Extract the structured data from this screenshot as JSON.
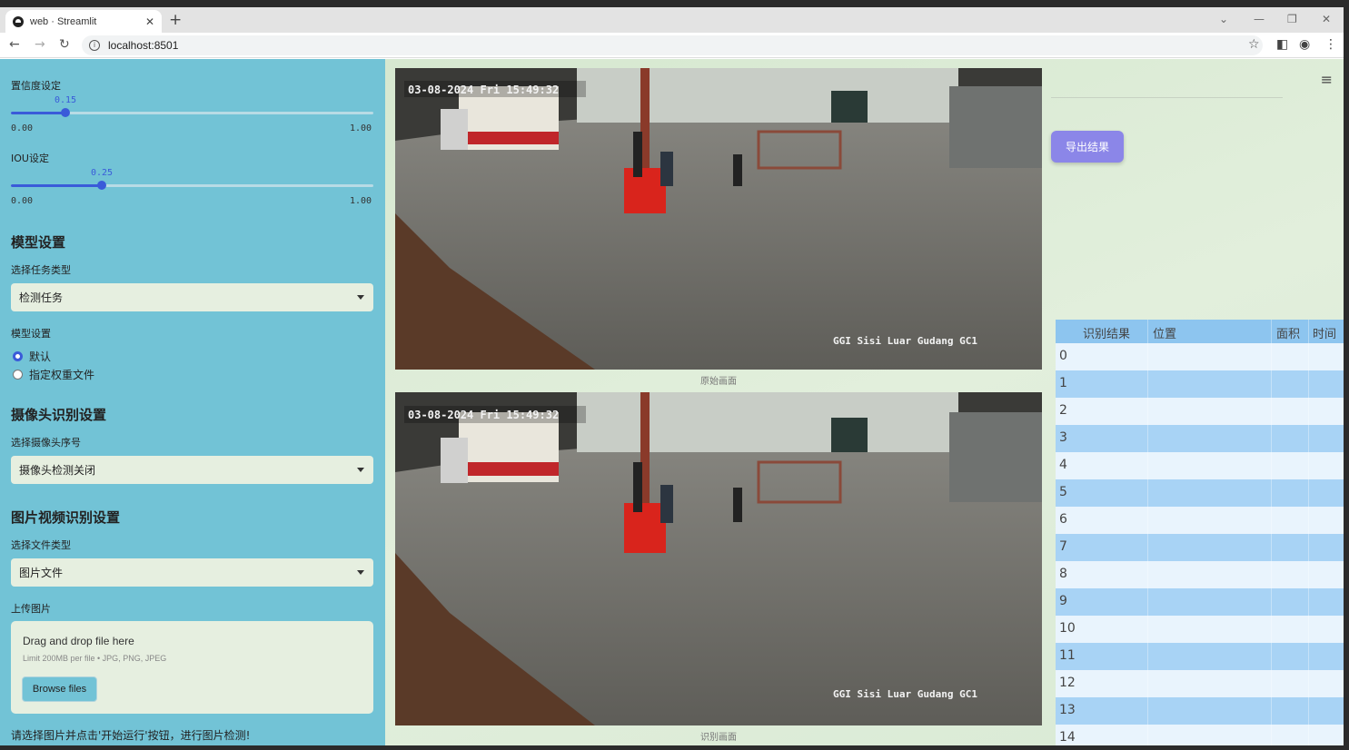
{
  "browser": {
    "tab_title": "web · Streamlit",
    "url": "localhost:8501"
  },
  "sidebar": {
    "confidence_label": "置信度设定",
    "confidence_value": "0.15",
    "confidence_fraction": 0.15,
    "confidence_min": "0.00",
    "confidence_max": "1.00",
    "iou_label": "IOU设定",
    "iou_value": "0.25",
    "iou_fraction": 0.25,
    "iou_min": "0.00",
    "iou_max": "1.00",
    "model_heading": "模型设置",
    "task_type_label": "选择任务类型",
    "task_type_value": "检测任务",
    "model_settings_label": "模型设置",
    "model_options": [
      "默认",
      "指定权重文件"
    ],
    "model_selected": 0,
    "camera_heading": "摄像头识别设置",
    "camera_label": "选择摄像头序号",
    "camera_value": "摄像头检测关闭",
    "media_heading": "图片视频识别设置",
    "file_type_label": "选择文件类型",
    "file_type_value": "图片文件",
    "upload_label": "上传图片",
    "dropzone_title": "Drag and drop file here",
    "dropzone_limit": "Limit 200MB per file • JPG, PNG, JPEG",
    "browse_label": "Browse files",
    "hint": "请选择图片并点击'开始运行'按钮，进行图片检测!"
  },
  "main": {
    "original_caption": "原始画面",
    "result_caption": "识别画面",
    "overlay_timestamp": "03-08-2024 Fri 15:49:32",
    "overlay_camera": "GGI Sisi Luar Gudang GC1",
    "export_label": "导出结果"
  },
  "table": {
    "headers": [
      "识别结果",
      "位置",
      "面积",
      "时间"
    ],
    "rows": [
      "0",
      "1",
      "2",
      "3",
      "4",
      "5",
      "6",
      "7",
      "8",
      "9",
      "10",
      "11",
      "12",
      "13",
      "14"
    ]
  },
  "colors": {
    "sidebar_bg": "#72c3d6",
    "accent": "#3a5bd9",
    "export_button": "#8b86e8",
    "table_header": "#8dc5ef"
  }
}
